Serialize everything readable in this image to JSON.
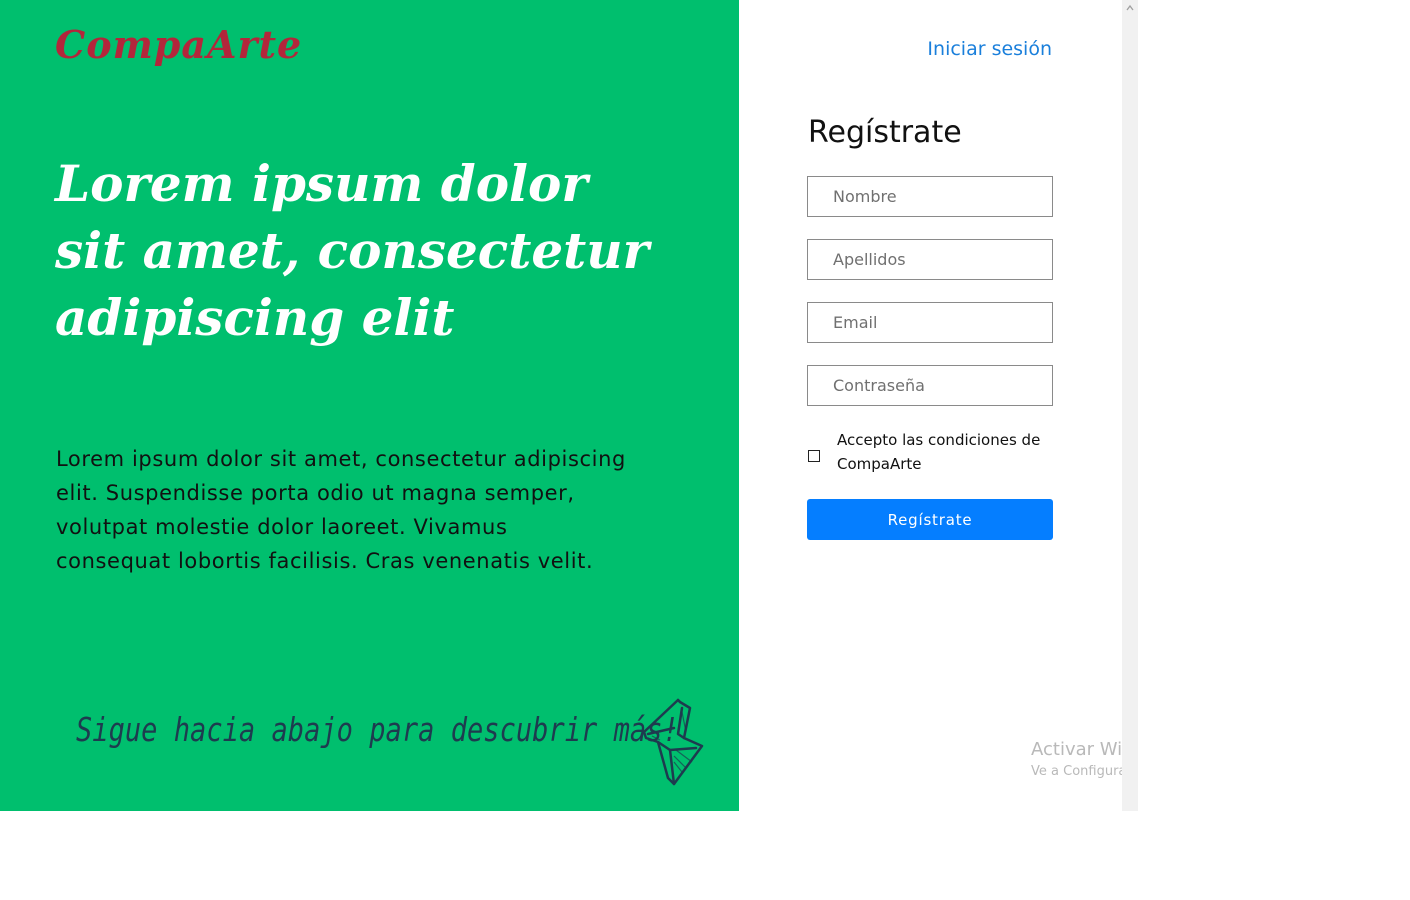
{
  "brand": {
    "logo": "CompaArte",
    "logo_color": "#b3263b",
    "hero_background": "#00bf6e"
  },
  "hero": {
    "headline": "Lorem ipsum dolor sit amet, consectetur adipiscing elit",
    "body": "Lorem ipsum dolor sit amet, consectetur adipiscing elit. Suspendisse porta odio ut magna semper, volutpat molestie dolor laoreet. Vivamus consequat lobortis facilisis. Cras venenatis velit.",
    "scroll_hint": "Sigue hacia abajo para descubrir más!",
    "scroll_icon": "sketch-arrow-icon"
  },
  "header": {
    "login_link": "Iniciar sesión",
    "link_color": "#1a7fdb"
  },
  "form": {
    "title": "Regístrate",
    "fields": {
      "first_name": {
        "placeholder": "Nombre",
        "value": ""
      },
      "last_name": {
        "placeholder": "Apellidos",
        "value": ""
      },
      "email": {
        "placeholder": "Email",
        "value": ""
      },
      "password": {
        "placeholder": "Contraseña",
        "value": ""
      }
    },
    "terms": {
      "label": "Accepto las condiciones de CompaArte",
      "checked": false
    },
    "submit_label": "Regístrate",
    "submit_color": "#057eff"
  },
  "system": {
    "watermark_title": "Activar Windows",
    "watermark_subtitle": "Ve a Configuración para activar Windows."
  }
}
